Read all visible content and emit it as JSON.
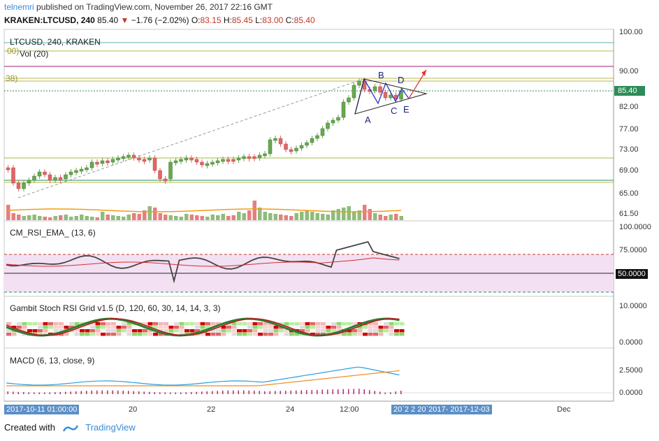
{
  "header": {
    "user": "telnemri",
    "published_text": " published on TradingView.com, November 26, 2017 22:16 GMT",
    "symbol": "KRAKEN:LTCUSD, 240",
    "last": "85.40",
    "change": "−1.76 (−2.02%)",
    "o_label": "O:",
    "o": "83.15",
    "h_label": "H:",
    "h": "85.45",
    "l_label": "L:",
    "l": "83.00",
    "c_label": "C:",
    "c": "85.40"
  },
  "panes": {
    "main_title": "LTCUSD, 240, KRAKEN",
    "vol_label": "Vol (20)",
    "fib_top_label": "00)",
    "fib_38_label": "38)",
    "rsi_label": "CM_RSI_EMA_ (13, 6)",
    "stoch_label": "Gambit Stoch RSI Grid v1.5 (D, 120, 60, 30, 14, 14, 3, 3)",
    "macd_label": "MACD (6, 13, close, 9)"
  },
  "price_axis": [
    "100.00",
    "90.00",
    "82.00",
    "77.00",
    "73.00",
    "69.00",
    "65.00",
    "61.50"
  ],
  "price_tag": "85.40",
  "rsi_axis": [
    "100.0000",
    "75.0000",
    "50.0000"
  ],
  "stoch_axis": [
    "10.0000",
    "0.0000"
  ],
  "macd_axis": [
    "2.5000",
    "0.0000"
  ],
  "time_axis": [
    "20",
    "22",
    "24",
    "12:00",
    "Dec"
  ],
  "time_tag_left": "2017-10-11 01:00:00",
  "time_tag_right": "20`2 2 20`2017- 2017-12-03",
  "wave_labels": [
    "A",
    "B",
    "C",
    "D",
    "E"
  ],
  "footer": {
    "created": "Created with",
    "brand": "TradingView"
  },
  "colors": {
    "up": "#6aa84f",
    "down": "#e06666",
    "accent": "#3a8bd8",
    "rsi_fill": "#f3e1f3",
    "macd_line": "#2ca0dc",
    "signal_line": "#f08a24"
  }
}
